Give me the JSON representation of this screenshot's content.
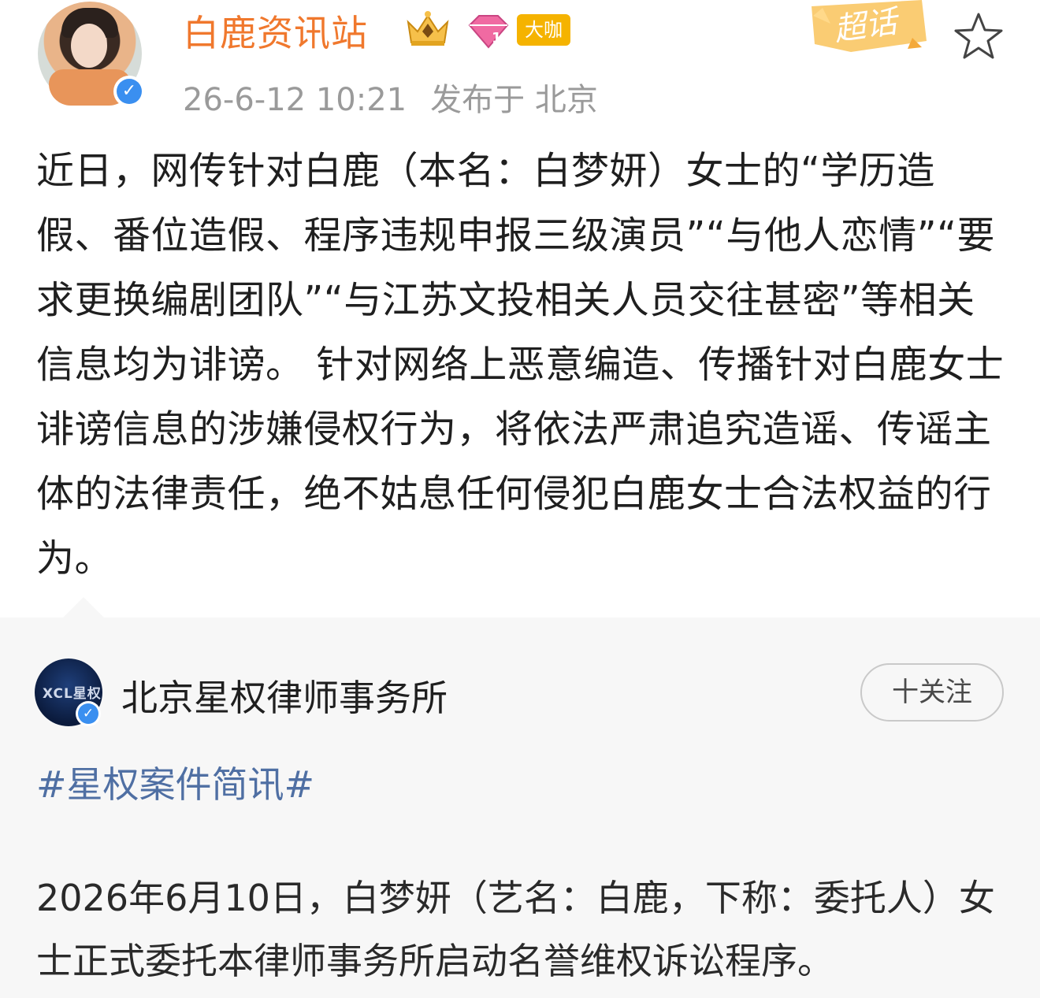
{
  "post": {
    "username": "白鹿资讯站",
    "badge_daka": "大咖",
    "chaohua_label": "超话",
    "timestamp": "26-6-12 10:21",
    "location": "发布于 北京",
    "body": "近日，网传针对白鹿（本名：白梦妍）女士的“学历造假、番位造假、程序违规申报三级演员”“与他人恋情”“要求更换编剧团队”“与江苏文投相关人员交往甚密”等相关信息均为诽谤。 针对网络上恶意编造、传播针对白鹿女士诽谤信息的涉嫌侵权行为，将依法严肃追究造谣、传谣主体的法律责任，绝不姑息任何侵犯白鹿女士合法权益的行为。"
  },
  "repost": {
    "author_name": "北京星权律师事务所",
    "logo_text": "XCL星权",
    "follow_label": "十关注",
    "hashtag": "#星权案件简讯#",
    "body": "2026年6月10日，白梦妍（艺名：白鹿，下称：委托人）女士正式委托本律师事务所启动名誉维权诉讼程序。"
  },
  "colors": {
    "username": "#f0782d",
    "verify": "#3a8ff0",
    "hashtag": "#4f6fa3",
    "daka_badge": "#f5b300"
  },
  "icons": [
    "crown-badge-icon",
    "diamond-badge-icon",
    "chaohua-icon",
    "star-icon",
    "verified-icon"
  ]
}
